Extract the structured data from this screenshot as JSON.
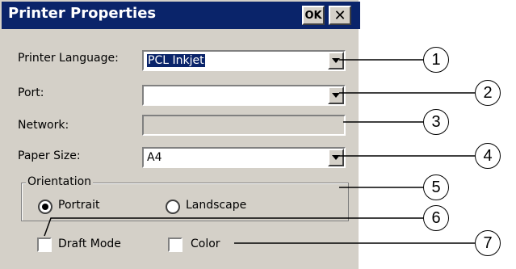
{
  "window": {
    "title": "Printer Properties",
    "ok_label": "OK",
    "close_label": "✕"
  },
  "fields": {
    "printer_language": {
      "label": "Printer Language:",
      "value": "PCL Inkjet"
    },
    "port": {
      "label": "Port:",
      "value": ""
    },
    "network": {
      "label": "Network:",
      "value": ""
    },
    "paper_size": {
      "label": "Paper Size:",
      "value": "A4"
    }
  },
  "orientation": {
    "label": "Orientation",
    "options": [
      {
        "label": "Portrait",
        "selected": true
      },
      {
        "label": "Landscape",
        "selected": false
      }
    ]
  },
  "checkboxes": [
    {
      "label": "Draft Mode",
      "checked": false
    },
    {
      "label": "Color",
      "checked": false
    }
  ],
  "callouts": [
    "1",
    "2",
    "3",
    "4",
    "5",
    "6",
    "7"
  ],
  "colors": {
    "titlebar": "#0a246a",
    "dialog": "#d4d0c8"
  }
}
